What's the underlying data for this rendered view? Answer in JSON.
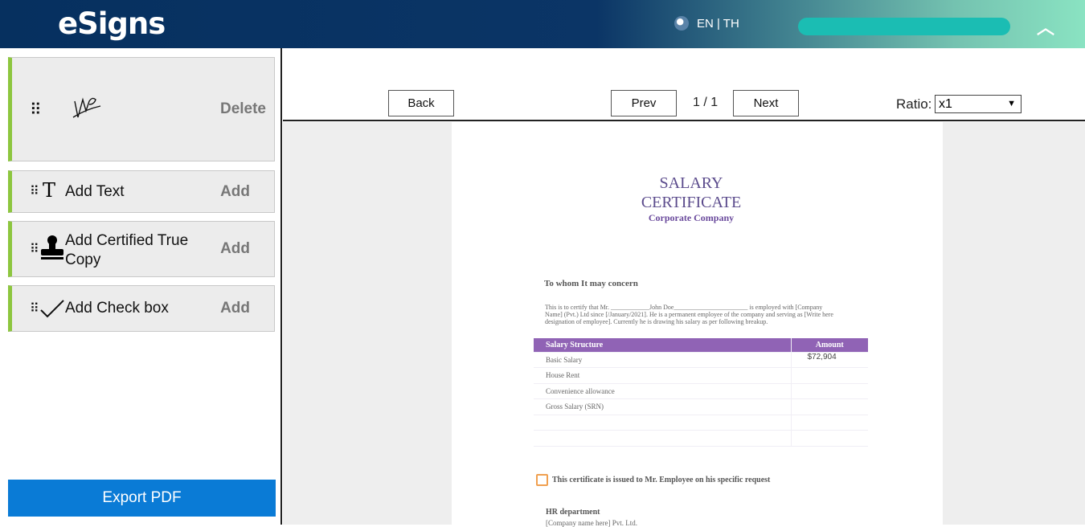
{
  "header": {
    "logo": "eSigns",
    "language": "EN | TH",
    "progress_percent": 100,
    "colors": {
      "progress": "#1bbdb3"
    }
  },
  "sidebar": {
    "items": [
      {
        "label": "",
        "icon": "signature-icon",
        "action": "Delete"
      },
      {
        "label": "Add Text",
        "icon": "text-cursor-icon",
        "action": "Add"
      },
      {
        "label": "Add Certified True Copy",
        "icon": "stamp-icon",
        "action": "Add"
      },
      {
        "label": "Add Check box",
        "icon": "checkmark-icon",
        "action": "Add"
      }
    ],
    "export_label": "Export PDF"
  },
  "toolbar": {
    "back": "Back",
    "prev": "Prev",
    "page_indicator": "1 / 1",
    "next": "Next",
    "ratio_label": "Ratio:",
    "ratio_value": "x1"
  },
  "document": {
    "title1": "SALARY",
    "title2": "CERTIFICATE",
    "company": "Corporate Company",
    "greeting": "To whom It may concern",
    "para1": "This is to certify that Mr. ____________John   Doe_______________________   is employed with [Company",
    "para2": "Name] (Pvt.) Ltd since [/January/2021]. He is a permanent employee of the company and serving  as [Write  here",
    "para3": "designation of employee]. Currently he is drawing his salary as per following breakup.",
    "table": {
      "headers": [
        "Salary  Structure",
        "Amount"
      ],
      "rows": [
        [
          "Basic Salary",
          "$72,904"
        ],
        [
          "House Rent",
          ""
        ],
        [
          "Convenience allowance",
          ""
        ],
        [
          "Gross Salary  (SRN)",
          ""
        ],
        [
          "",
          ""
        ],
        [
          "",
          ""
        ]
      ]
    },
    "checkbox_text": "This certificate is issued to Mr. Employee on his specific request",
    "dept": "HR department",
    "company_line": "[Company name here] Pvt. Ltd."
  }
}
